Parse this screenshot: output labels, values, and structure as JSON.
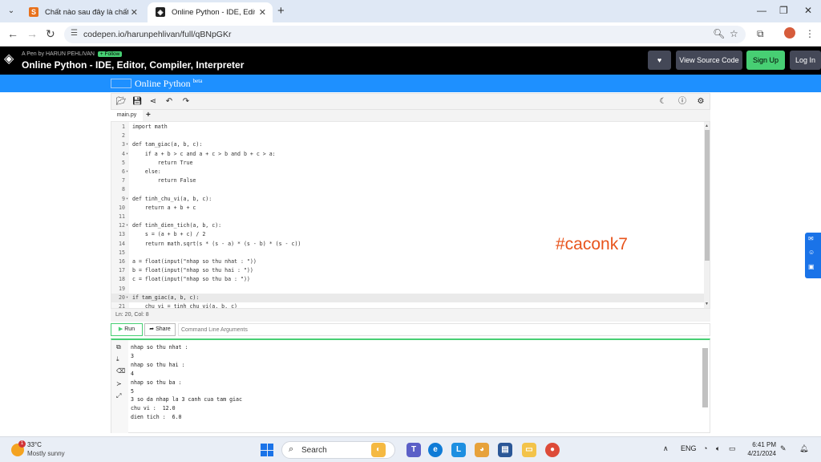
{
  "browser": {
    "tabs": [
      {
        "title": "Chất nào sau đây là chất rắn ở",
        "active": false
      },
      {
        "title": "Online Python - IDE, Editor, Co",
        "active": true
      }
    ],
    "url": "codepen.io/harunpehlivan/full/qBNpGKr"
  },
  "codepen": {
    "by_prefix": "A Pen by",
    "author": "HARUN PEHLIVAN",
    "follow_label": "+ Follow",
    "title": "Online Python - IDE, Editor, Compiler, Interpreter",
    "view_source_label": "View Source Code",
    "signup_label": "Sign Up",
    "login_label": "Log In"
  },
  "app": {
    "brand": "Online Python",
    "brand_sup": "beta",
    "file_tab": "main.py",
    "status": "Ln: 20,  Col: 8",
    "run_label": "Run",
    "share_label": "Share",
    "cmd_placeholder": "Command Line Arguments",
    "watermark": "#caconk7"
  },
  "code_lines": [
    {
      "n": "1",
      "fold": "",
      "text": "import math"
    },
    {
      "n": "2",
      "fold": "",
      "text": ""
    },
    {
      "n": "3",
      "fold": "▾",
      "text": "def tam_giac(a, b, c):"
    },
    {
      "n": "4",
      "fold": "▾",
      "text": "    if a + b > c and a + c > b and b + c > a:"
    },
    {
      "n": "5",
      "fold": "",
      "text": "        return True"
    },
    {
      "n": "6",
      "fold": "▾",
      "text": "    else:"
    },
    {
      "n": "7",
      "fold": "",
      "text": "        return False"
    },
    {
      "n": "8",
      "fold": "",
      "text": ""
    },
    {
      "n": "9",
      "fold": "▾",
      "text": "def tinh_chu_vi(a, b, c):"
    },
    {
      "n": "10",
      "fold": "",
      "text": "    return a + b + c"
    },
    {
      "n": "11",
      "fold": "",
      "text": ""
    },
    {
      "n": "12",
      "fold": "▾",
      "text": "def tinh_dien_tich(a, b, c):"
    },
    {
      "n": "13",
      "fold": "",
      "text": "    s = (a + b + c) / 2"
    },
    {
      "n": "14",
      "fold": "",
      "text": "    return math.sqrt(s * (s - a) * (s - b) * (s - c))"
    },
    {
      "n": "15",
      "fold": "",
      "text": ""
    },
    {
      "n": "16",
      "fold": "",
      "text": "a = float(input(\"nhap so thu nhat : \"))"
    },
    {
      "n": "17",
      "fold": "",
      "text": "b = float(input(\"nhap so thu hai : \"))"
    },
    {
      "n": "18",
      "fold": "",
      "text": "c = float(input(\"nhap so thu ba : \"))"
    },
    {
      "n": "19",
      "fold": "",
      "text": ""
    },
    {
      "n": "20",
      "fold": "▾",
      "text": "if tam_giac(a, b, c):"
    },
    {
      "n": "21",
      "fold": "",
      "text": "    chu_vi = tinh_chu_vi(a, b, c)"
    }
  ],
  "console_output": "nhap so thu nhat :\n3\nnhap so thu hai :\n4\nnhap so thu ba :\n5\n3 so da nhap la 3 canh cua tam giac\nchu vi :  12.0\ndien tich :  6.0",
  "taskbar": {
    "temperature": "33°C",
    "condition": "Mostly sunny",
    "weather_badge": "1",
    "search_label": "Search",
    "lang": "ENG",
    "time": "6:41 PM",
    "date": "4/21/2024"
  },
  "colors": {
    "codepen_green": "#47cf73",
    "brand_blue": "#1e90ff",
    "watermark": "#e8541c"
  }
}
